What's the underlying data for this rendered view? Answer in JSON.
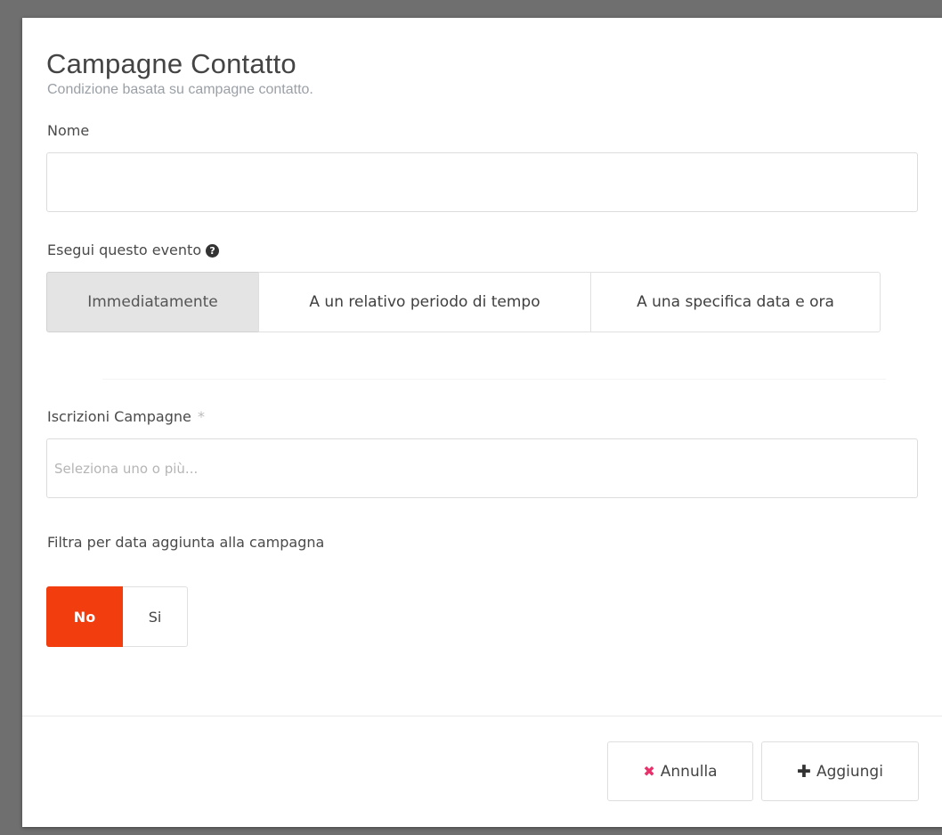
{
  "modal": {
    "title": "Campagne Contatto",
    "subtitle": "Condizione basata su campagne contatto."
  },
  "form": {
    "name_label": "Nome",
    "name_value": "",
    "event_label": "Esegui questo evento",
    "event_options": [
      "Immediatamente",
      "A un relativo periodo di tempo",
      "A una specifica data e ora"
    ],
    "event_selected": "Immediatamente",
    "campaigns_label": "Iscrizioni Campagne",
    "campaigns_required_mark": "*",
    "campaigns_placeholder": "Seleziona uno o più...",
    "filter_label": "Filtra per data aggiunta alla campagna",
    "filter_options": [
      "No",
      "Si"
    ],
    "filter_selected": "No"
  },
  "footer": {
    "cancel_label": "Annulla",
    "add_label": "Aggiungi"
  },
  "icons": {
    "help": "question-circle-icon",
    "cancel": "times-icon",
    "add": "plus-icon"
  },
  "colors": {
    "toggle_active": "#f23d0f",
    "cancel_icon": "#e8306a"
  }
}
